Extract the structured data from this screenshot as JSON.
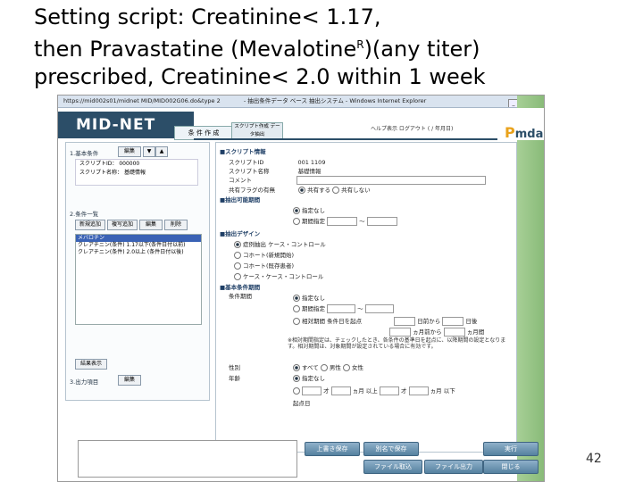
{
  "slide": {
    "title_line1": "Setting script: Creatinine< 1.17,",
    "title_line2_pre": "then Pravastatine (Mevalotine",
    "title_line2_sup": "R",
    "title_line2_post": ")(any titer)",
    "title_line3": "prescribed, Creatinine< 2.0 within 1 week",
    "page_number": "42"
  },
  "browser": {
    "url": "https://mid002s01/midnet MID/MID002G06.do&type 2",
    "title": "- 抽出条件データ ベース 抽出システム - Windows Internet Explorer",
    "btn_min": "_",
    "btn_max": "□",
    "btn_close": "x"
  },
  "app": {
    "logo": "MID-NET",
    "tab_condition": "条 件 作 成",
    "tab_script": "スクリプト作成 データ抽出",
    "header_right": "ヘルプ表示 ログアウト ( / 年月日)",
    "brand": "mda",
    "brand_p": "P"
  },
  "left": {
    "section1": "1.基本条件",
    "btn_edit": "編集",
    "btn_up": "▼",
    "btn_down": "▲",
    "script_id_label": "スクリプトID：",
    "script_id_value": "000000",
    "script_name_label": "スクリプト名称：",
    "script_name_value": "基礎情報",
    "section2": "2.条件一覧",
    "btn_new": "新規追加",
    "btn_copy": "複写追加",
    "btn_edit2": "編集",
    "btn_delete": "削除",
    "list_items": [
      "メバロチン",
      "クレアチニン(条件) 1.17以下(条件日付以前)",
      "クレアチニン(条件) 2.0以上 (条件日付以後)"
    ],
    "btn_run_result": "結果表示",
    "section3": "3.出力項目",
    "btn_edit3": "編集"
  },
  "main": {
    "sec_script": "■スクリプト情報",
    "lbl_script_id": "スクリプトID",
    "val_script_id": "001 1109",
    "lbl_script_name": "スクリプト名称",
    "val_script_name": "基礎情報",
    "lbl_comment": "コメント",
    "lbl_share": "共有フラグの有無",
    "opt_share_yes": "共有する",
    "opt_share_no": "共有しない",
    "sec_period": "■抽出可能期間",
    "opt_period_none": "指定なし",
    "opt_period_range": "期間指定",
    "sec_design": "■抽出デザイン",
    "design_opts": [
      "症例抽出 ケース・コントロール",
      "コホート(新規開始)",
      "コホート(既存患者)",
      "ケース・ケース・コントロール"
    ],
    "sec_basic": "■基本条件期間",
    "lbl_date_cond": "条件期間",
    "opt_date_none": "指定なし",
    "opt_date_from": "期間指定",
    "opt_date_rel": "相対期間",
    "rel_text": "条件日を起点",
    "rel_before": "日前から",
    "rel_after": "日後",
    "rel_month": "ヵ月前から",
    "rel_month_after": "ヵ月間",
    "note": "※相対期間指定は、チェックしたとき、各条件の基準日を起点に、以降期間の設定となります。相対期間は、対象期間が設定されている場合に有効です。",
    "lbl_sex": "性別",
    "opt_sex_all": "すべて",
    "opt_sex_m": "男性",
    "opt_sex_f": "女性",
    "lbl_age": "年齢",
    "opt_age_none": "指定なし",
    "age_text1": "才",
    "age_text2": "ヵ月 以上",
    "age_text3": "才",
    "age_text4": "ヵ月 以下",
    "lbl_basis": "起点日"
  },
  "buttons": {
    "overwrite": "上書き保存",
    "save_as": "別名で保存",
    "run": "実行",
    "file_import": "ファイル取込",
    "file_export": "ファイル出力",
    "close": "閉じる"
  }
}
